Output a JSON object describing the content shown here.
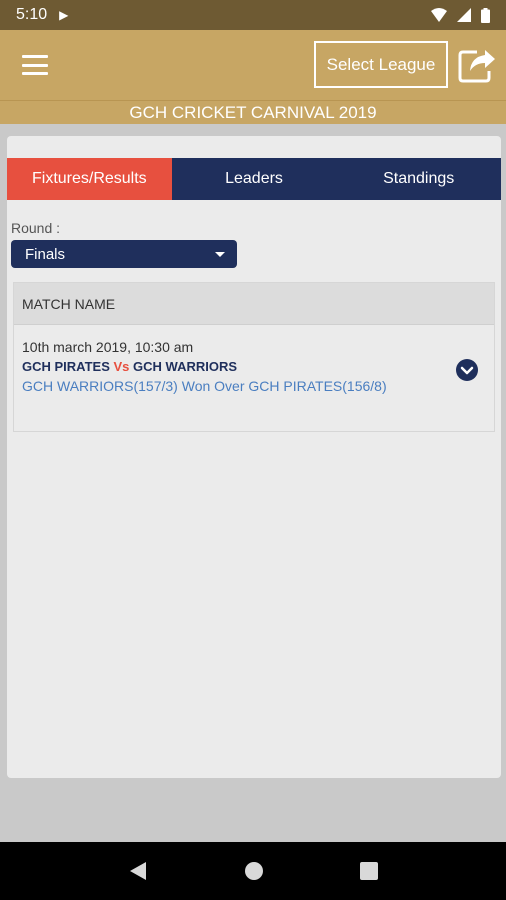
{
  "status_bar": {
    "time": "5:10"
  },
  "header": {
    "select_league_label": "Select League",
    "banner_title": "GCH CRICKET CARNIVAL 2019"
  },
  "tabs": [
    {
      "label": "Fixtures/Results"
    },
    {
      "label": "Leaders"
    },
    {
      "label": "Standings"
    }
  ],
  "round": {
    "label": "Round :",
    "selected": "Finals"
  },
  "table": {
    "header": "MATCH NAME",
    "rows": [
      {
        "date": "10th march 2019, 10:30 am",
        "team_a": "GCH PIRATES",
        "vs": "Vs",
        "team_b": "GCH WARRIORS",
        "result": "GCH WARRIORS(157/3) Won Over GCH PIRATES(156/8)"
      }
    ]
  },
  "colors": {
    "gold": "#c7a664",
    "navy": "#1f2f5c",
    "accent_red": "#e7503f",
    "link_blue": "#4a7ec0"
  },
  "icons": [
    "menu-icon",
    "share-icon",
    "chevron-down-icon",
    "back-icon",
    "home-icon",
    "recents-icon"
  ]
}
